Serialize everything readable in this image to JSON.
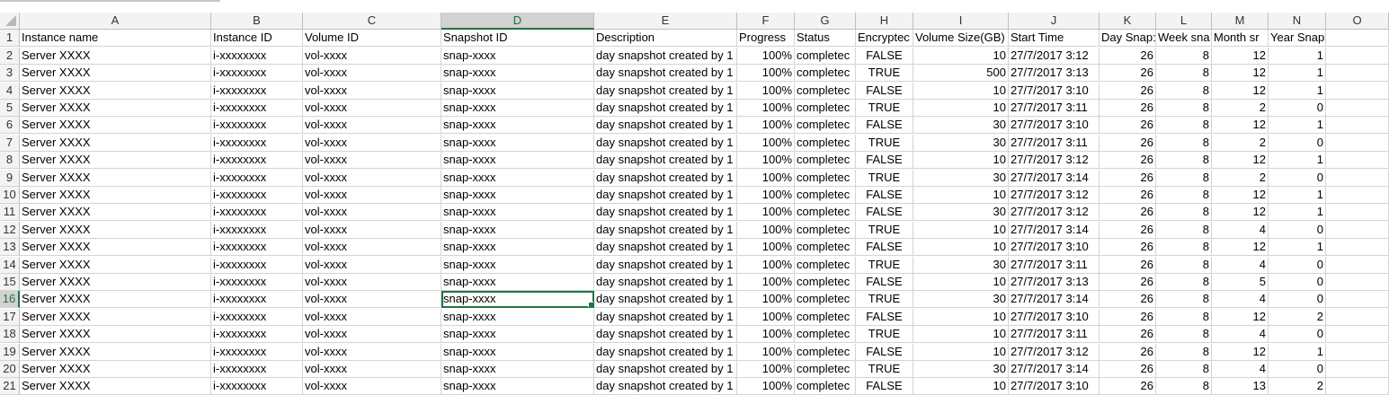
{
  "column_letters": [
    "A",
    "B",
    "C",
    "D",
    "E",
    "F",
    "G",
    "H",
    "I",
    "J",
    "K",
    "L",
    "M",
    "N",
    "O"
  ],
  "selected_column": "D",
  "selected_row": "16",
  "active_cell": "D16",
  "headers": [
    "Instance name",
    "Instance ID",
    "Volume ID",
    "Snapshot ID",
    "Description",
    "Progress",
    "Status",
    "Encryptec",
    "Volume Size(GB)",
    "Start Time",
    "Day Snap:",
    "Week sna",
    "Month sr",
    "Year Snapshots",
    ""
  ],
  "rows": [
    {
      "n": "2",
      "c": [
        "Server XXXX",
        "i-xxxxxxxx",
        "vol-xxxx",
        "snap-xxxx",
        "day snapshot created by 1",
        "100%",
        "completec",
        "FALSE",
        "10",
        "27/7/2017 3:12",
        "26",
        "8",
        "12",
        "1",
        ""
      ]
    },
    {
      "n": "3",
      "c": [
        "Server XXXX",
        "i-xxxxxxxx",
        "vol-xxxx",
        "snap-xxxx",
        "day snapshot created by 1",
        "100%",
        "completec",
        "TRUE",
        "500",
        "27/7/2017 3:13",
        "26",
        "8",
        "12",
        "1",
        ""
      ]
    },
    {
      "n": "4",
      "c": [
        "Server XXXX",
        "i-xxxxxxxx",
        "vol-xxxx",
        "snap-xxxx",
        "day snapshot created by 1",
        "100%",
        "completec",
        "FALSE",
        "10",
        "27/7/2017 3:10",
        "26",
        "8",
        "12",
        "1",
        ""
      ]
    },
    {
      "n": "5",
      "c": [
        "Server XXXX",
        "i-xxxxxxxx",
        "vol-xxxx",
        "snap-xxxx",
        "day snapshot created by 1",
        "100%",
        "completec",
        "TRUE",
        "10",
        "27/7/2017 3:11",
        "26",
        "8",
        "2",
        "0",
        ""
      ]
    },
    {
      "n": "6",
      "c": [
        "Server XXXX",
        "i-xxxxxxxx",
        "vol-xxxx",
        "snap-xxxx",
        "day snapshot created by 1",
        "100%",
        "completec",
        "FALSE",
        "30",
        "27/7/2017 3:10",
        "26",
        "8",
        "12",
        "1",
        ""
      ]
    },
    {
      "n": "7",
      "c": [
        "Server XXXX",
        "i-xxxxxxxx",
        "vol-xxxx",
        "snap-xxxx",
        "day snapshot created by 1",
        "100%",
        "completec",
        "TRUE",
        "30",
        "27/7/2017 3:11",
        "26",
        "8",
        "2",
        "0",
        ""
      ]
    },
    {
      "n": "8",
      "c": [
        "Server XXXX",
        "i-xxxxxxxx",
        "vol-xxxx",
        "snap-xxxx",
        "day snapshot created by 1",
        "100%",
        "completec",
        "FALSE",
        "10",
        "27/7/2017 3:12",
        "26",
        "8",
        "12",
        "1",
        ""
      ]
    },
    {
      "n": "9",
      "c": [
        "Server XXXX",
        "i-xxxxxxxx",
        "vol-xxxx",
        "snap-xxxx",
        "day snapshot created by 1",
        "100%",
        "completec",
        "TRUE",
        "30",
        "27/7/2017 3:14",
        "26",
        "8",
        "2",
        "0",
        ""
      ]
    },
    {
      "n": "10",
      "c": [
        "Server XXXX",
        "i-xxxxxxxx",
        "vol-xxxx",
        "snap-xxxx",
        "day snapshot created by 1",
        "100%",
        "completec",
        "FALSE",
        "10",
        "27/7/2017 3:12",
        "26",
        "8",
        "12",
        "1",
        ""
      ]
    },
    {
      "n": "11",
      "c": [
        "Server XXXX",
        "i-xxxxxxxx",
        "vol-xxxx",
        "snap-xxxx",
        "day snapshot created by 1",
        "100%",
        "completec",
        "FALSE",
        "30",
        "27/7/2017 3:12",
        "26",
        "8",
        "12",
        "1",
        ""
      ]
    },
    {
      "n": "12",
      "c": [
        "Server XXXX",
        "i-xxxxxxxx",
        "vol-xxxx",
        "snap-xxxx",
        "day snapshot created by 1",
        "100%",
        "completec",
        "TRUE",
        "10",
        "27/7/2017 3:14",
        "26",
        "8",
        "4",
        "0",
        ""
      ]
    },
    {
      "n": "13",
      "c": [
        "Server XXXX",
        "i-xxxxxxxx",
        "vol-xxxx",
        "snap-xxxx",
        "day snapshot created by 1",
        "100%",
        "completec",
        "FALSE",
        "10",
        "27/7/2017 3:10",
        "26",
        "8",
        "12",
        "1",
        ""
      ]
    },
    {
      "n": "14",
      "c": [
        "Server XXXX",
        "i-xxxxxxxx",
        "vol-xxxx",
        "snap-xxxx",
        "day snapshot created by 1",
        "100%",
        "completec",
        "TRUE",
        "30",
        "27/7/2017 3:11",
        "26",
        "8",
        "4",
        "0",
        ""
      ]
    },
    {
      "n": "15",
      "c": [
        "Server XXXX",
        "i-xxxxxxxx",
        "vol-xxxx",
        "snap-xxxx",
        "day snapshot created by 1",
        "100%",
        "completec",
        "FALSE",
        "10",
        "27/7/2017 3:13",
        "26",
        "8",
        "5",
        "0",
        ""
      ]
    },
    {
      "n": "16",
      "c": [
        "Server XXXX",
        "i-xxxxxxxx",
        "vol-xxxx",
        "snap-xxxx",
        "day snapshot created by 1",
        "100%",
        "completec",
        "TRUE",
        "30",
        "27/7/2017 3:14",
        "26",
        "8",
        "4",
        "0",
        ""
      ]
    },
    {
      "n": "17",
      "c": [
        "Server XXXX",
        "i-xxxxxxxx",
        "vol-xxxx",
        "snap-xxxx",
        "day snapshot created by 1",
        "100%",
        "completec",
        "FALSE",
        "10",
        "27/7/2017 3:10",
        "26",
        "8",
        "12",
        "2",
        ""
      ]
    },
    {
      "n": "18",
      "c": [
        "Server XXXX",
        "i-xxxxxxxx",
        "vol-xxxx",
        "snap-xxxx",
        "day snapshot created by 1",
        "100%",
        "completec",
        "TRUE",
        "10",
        "27/7/2017 3:11",
        "26",
        "8",
        "4",
        "0",
        ""
      ]
    },
    {
      "n": "19",
      "c": [
        "Server XXXX",
        "i-xxxxxxxx",
        "vol-xxxx",
        "snap-xxxx",
        "day snapshot created by 1",
        "100%",
        "completec",
        "FALSE",
        "10",
        "27/7/2017 3:12",
        "26",
        "8",
        "12",
        "1",
        ""
      ]
    },
    {
      "n": "20",
      "c": [
        "Server XXXX",
        "i-xxxxxxxx",
        "vol-xxxx",
        "snap-xxxx",
        "day snapshot created by 1",
        "100%",
        "completec",
        "TRUE",
        "30",
        "27/7/2017 3:14",
        "26",
        "8",
        "4",
        "0",
        ""
      ]
    },
    {
      "n": "21",
      "c": [
        "Server XXXX",
        "i-xxxxxxxx",
        "vol-xxxx",
        "snap-xxxx",
        "day snapshot created by 1",
        "100%",
        "completec",
        "FALSE",
        "10",
        "27/7/2017 3:10",
        "26",
        "8",
        "13",
        "2",
        ""
      ]
    }
  ],
  "colors": {
    "selection": "#217346",
    "header_bg": "#f3f3f3",
    "gridline": "#d4d4d4"
  }
}
